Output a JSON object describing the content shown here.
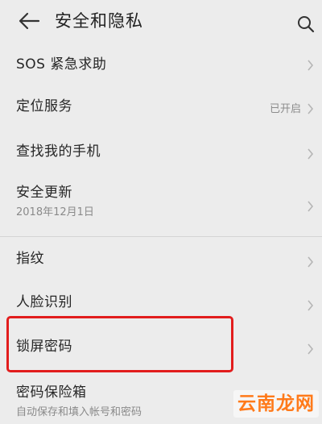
{
  "header": {
    "title": "安全和隐私",
    "back_icon": "back-arrow-icon",
    "search_icon": "search-icon"
  },
  "items": [
    {
      "title": "SOS 紧急求助",
      "value": "",
      "subtitle": ""
    },
    {
      "title": "定位服务",
      "value": "已开启",
      "subtitle": ""
    },
    {
      "title": "查找我的手机",
      "value": "",
      "subtitle": ""
    },
    {
      "title": "安全更新",
      "value": "",
      "subtitle": "2018年12月1日"
    },
    {
      "title": "指纹",
      "value": "",
      "subtitle": ""
    },
    {
      "title": "人脸识别",
      "value": "",
      "subtitle": ""
    },
    {
      "title": "锁屏密码",
      "value": "",
      "subtitle": ""
    },
    {
      "title": "密码保险箱",
      "value": "",
      "subtitle": "自动保存和填入帐号和密码"
    }
  ],
  "annotation": {
    "highlight_color": "#e21d1d",
    "highlighted_item": "锁屏密码"
  },
  "watermark": {
    "text": "云南龙网",
    "color": "#ff7a1a"
  },
  "colors": {
    "background": "#ececec",
    "divider": "#d4d4d4"
  }
}
